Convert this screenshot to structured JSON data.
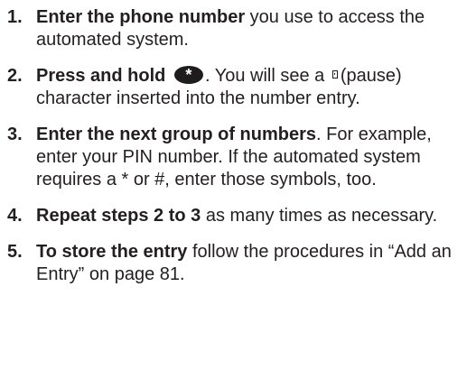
{
  "steps": [
    {
      "number": "1.",
      "bold": "Enter the phone number",
      "text": " you use to access the automated system."
    },
    {
      "number": "2.",
      "bold": "Press and hold",
      "key_icon": "asterisk-key-icon",
      "text_a": ". You will see a",
      "pause_icon": "pause-character-icon",
      "text_b": "(pause) character inserted into the number entry."
    },
    {
      "number": "3.",
      "bold": "Enter the next group of numbers",
      "text": ". For example, enter your PIN number. If the automated system requires a * or #, enter those symbols, too."
    },
    {
      "number": "4.",
      "bold": "Repeat steps 2 to 3",
      "text": " as many times as necessary."
    },
    {
      "number": "5.",
      "bold": "To store the entry",
      "text": " follow the procedures in “Add an Entry” on page 81."
    }
  ]
}
